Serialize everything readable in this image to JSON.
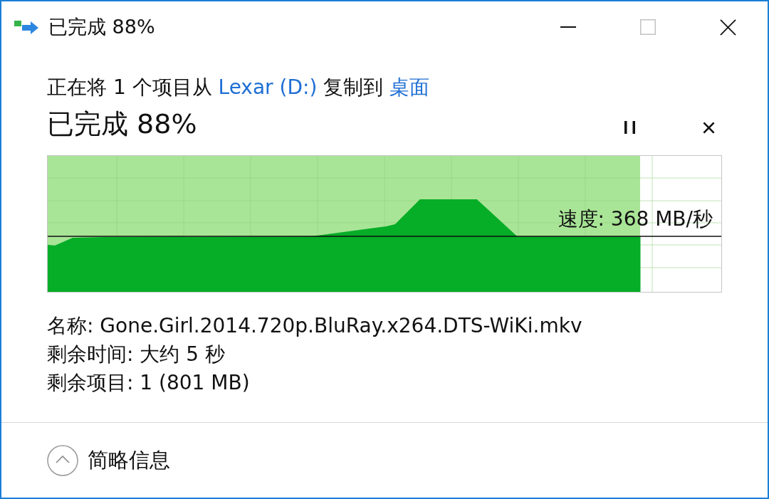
{
  "window": {
    "title": "已完成 88%",
    "controls": [
      {
        "kind": "minimize",
        "disabled": false
      },
      {
        "kind": "maximize",
        "disabled": true
      },
      {
        "kind": "close",
        "disabled": false
      }
    ]
  },
  "copy_line": [
    {
      "kind": "text",
      "text": "正在将 1 个项目从"
    },
    {
      "kind": "link",
      "text": "Lexar (D:)"
    },
    {
      "kind": "text",
      "text": "复制到"
    },
    {
      "kind": "link",
      "text": "桌面"
    }
  ],
  "progress": {
    "heading": "已完成 88%",
    "level": 0.88,
    "speed": "速度: 368 MB/秒"
  },
  "details": [
    "名称: Gone.Girl.2014.720p.BluRay.x264.DTS-WiKi.mkv",
    "剩余时间: 大约 5 秒",
    "剩余项目: 1 (801 MB)"
  ],
  "footer": {
    "toggle_label": "简略信息",
    "expanded": true
  }
}
